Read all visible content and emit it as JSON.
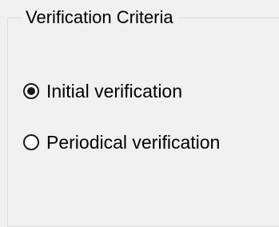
{
  "group": {
    "title": "Verification Criteria"
  },
  "options": [
    {
      "label": "Initial verification",
      "selected": true
    },
    {
      "label": "Periodical verification",
      "selected": false
    }
  ]
}
